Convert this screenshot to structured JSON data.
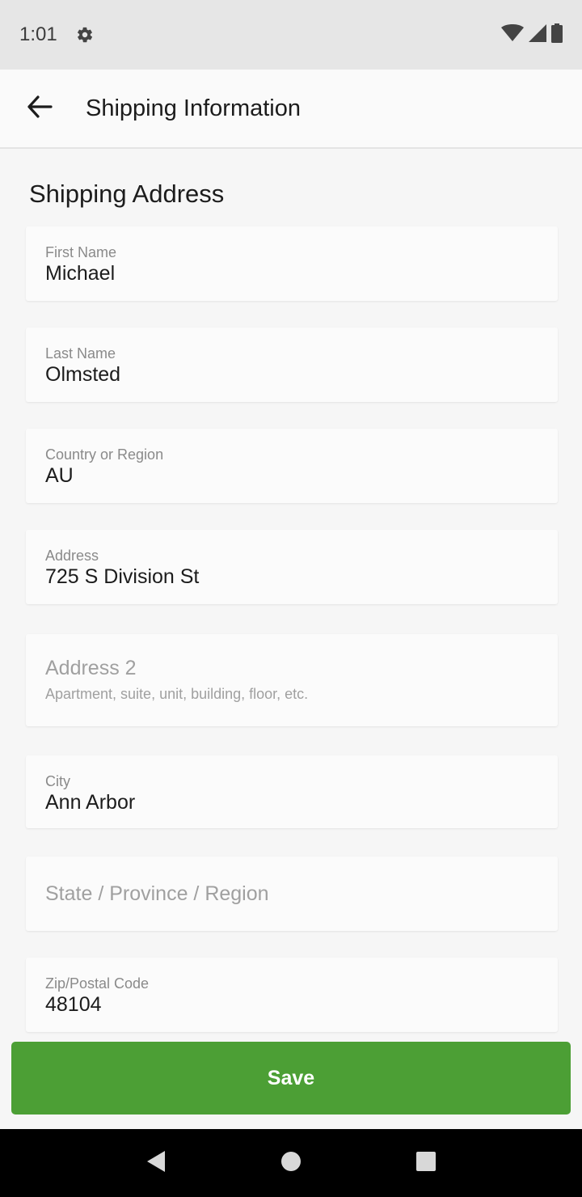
{
  "status_bar": {
    "time": "1:01",
    "icons": [
      "gear-icon",
      "wifi-icon",
      "signal-icon",
      "battery-icon"
    ]
  },
  "app_bar": {
    "title": "Shipping Information",
    "back_icon": "arrow-left-icon"
  },
  "form": {
    "section_title": "Shipping Address",
    "fields": [
      {
        "label": "First Name",
        "value": "Michael"
      },
      {
        "label": "Last Name",
        "value": "Olmsted"
      },
      {
        "label": "Country or Region",
        "value": "AU"
      },
      {
        "label": "Address",
        "value": "725 S Division St"
      },
      {
        "placeholder": "Address 2",
        "helper": "Apartment, suite, unit, building, floor, etc."
      },
      {
        "label": "City",
        "value": "Ann Arbor"
      },
      {
        "placeholder": "State / Province / Region"
      },
      {
        "label": "Zip/Postal Code",
        "value": "48104"
      }
    ]
  },
  "save_button": {
    "label": "Save"
  },
  "nav_bar": {
    "icons": [
      "back-triangle-icon",
      "home-circle-icon",
      "recents-square-icon"
    ]
  },
  "colors": {
    "accent": "#4c9f35",
    "status_bar": "#e6e6e6",
    "nav_bar": "#000000",
    "background": "#f6f6f6"
  }
}
